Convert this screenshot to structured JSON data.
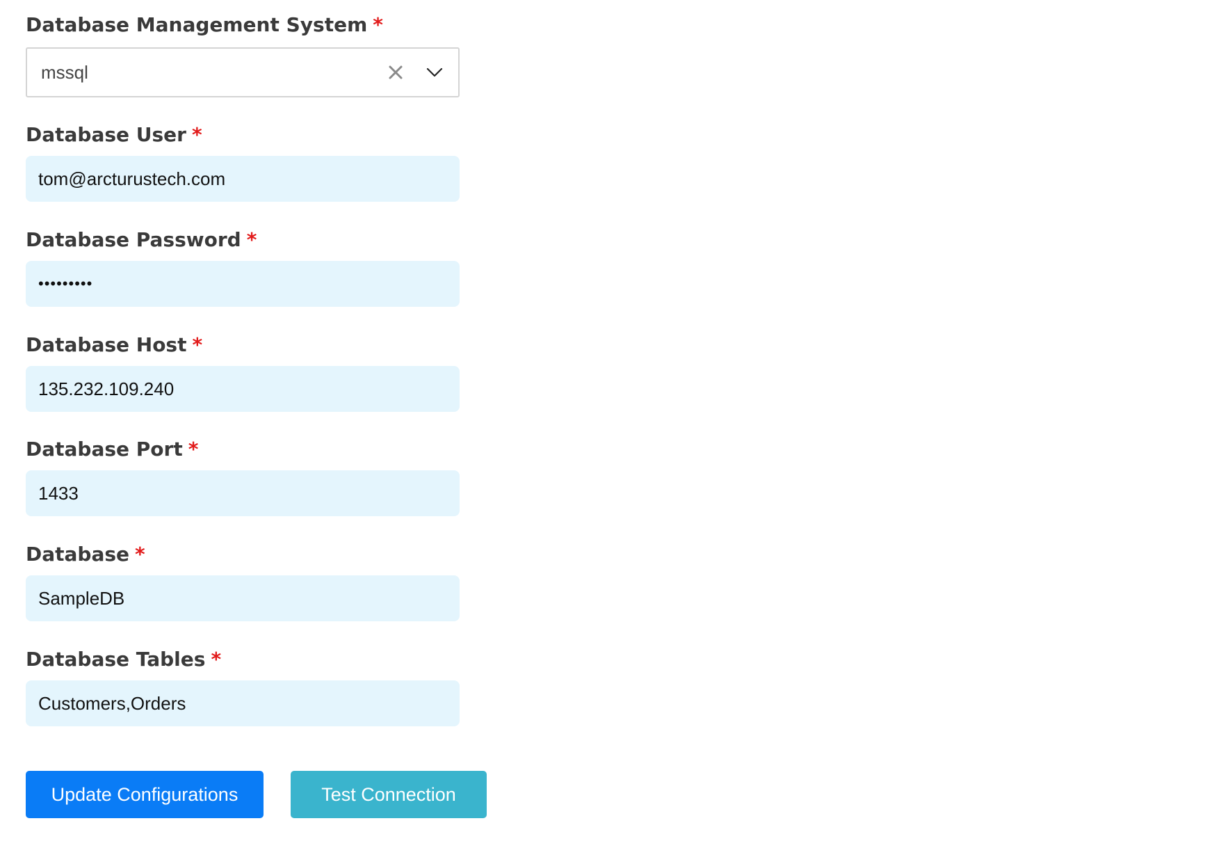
{
  "form": {
    "dbms": {
      "label": "Database Management System",
      "required_mark": "*",
      "selected_value": "mssql",
      "clear_icon": "close-icon",
      "dropdown_icon": "chevron-down-icon"
    },
    "user": {
      "label": "Database User",
      "required_mark": "*",
      "value": "tom@arcturustech.com"
    },
    "password": {
      "label": "Database Password",
      "required_mark": "*",
      "value": "•••••••••"
    },
    "host": {
      "label": "Database Host",
      "required_mark": "*",
      "value": "135.232.109.240"
    },
    "port": {
      "label": "Database Port",
      "required_mark": "*",
      "value": "1433"
    },
    "database": {
      "label": "Database",
      "required_mark": "*",
      "value": "SampleDB"
    },
    "tables": {
      "label": "Database Tables",
      "required_mark": "*",
      "value": "Customers,Orders"
    }
  },
  "actions": {
    "update_label": "Update Configurations",
    "test_label": "Test Connection"
  },
  "colors": {
    "input_background": "#e4f5fd",
    "required": "#e21b1b",
    "primary_button": "#0a7cf6",
    "secondary_button": "#3ab4cd",
    "label_text": "#3a3a3a"
  }
}
